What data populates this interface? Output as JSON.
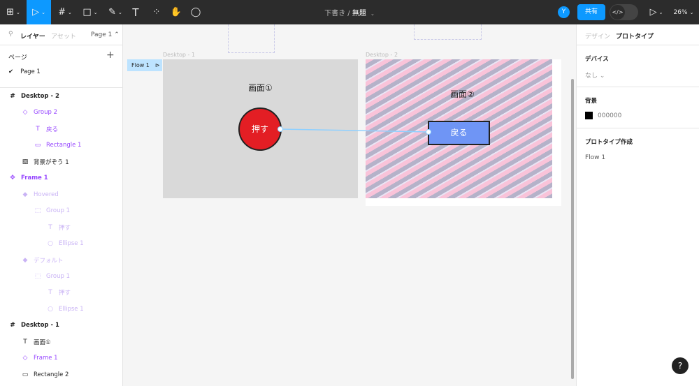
{
  "toolbar": {
    "tools": [
      "figma-menu-icon",
      "move-icon",
      "frame-icon",
      "rectangle-icon",
      "pen-icon",
      "text-icon",
      "components-icon",
      "hand-icon",
      "comment-icon"
    ],
    "breadcrumb": "下書き",
    "separator": "/",
    "file_name": "無題",
    "avatar": "Y",
    "share": "共有",
    "zoom": "26%"
  },
  "left": {
    "tab_layers": "レイヤー",
    "tab_assets": "アセット",
    "page_select": "Page 1",
    "pages_heading": "ページ",
    "pages": [
      "Page 1"
    ],
    "layers": [
      {
        "name": "Desktop - 2",
        "icon": "#",
        "indent": 0,
        "style": "bold"
      },
      {
        "name": "Group 2",
        "icon": "◇",
        "indent": 1,
        "style": "purple"
      },
      {
        "name": "戻る",
        "icon": "T",
        "indent": 2,
        "style": "purple"
      },
      {
        "name": "Rectangle 1",
        "icon": "▭",
        "indent": 2,
        "style": "purple"
      },
      {
        "name": "背景がぞう 1",
        "icon": "▨",
        "indent": 1,
        "style": ""
      },
      {
        "name": "Frame 1",
        "icon": "✥",
        "indent": 0,
        "style": "purple bold"
      },
      {
        "name": "Hovered",
        "icon": "◆",
        "indent": 1,
        "style": "faint"
      },
      {
        "name": "Group 1",
        "icon": "⬚",
        "indent": 2,
        "style": "faint"
      },
      {
        "name": "押す",
        "icon": "T",
        "indent": 3,
        "style": "faint"
      },
      {
        "name": "Ellipse 1",
        "icon": "○",
        "indent": 3,
        "style": "faint"
      },
      {
        "name": "デフォルト",
        "icon": "◆",
        "indent": 1,
        "style": "faint"
      },
      {
        "name": "Group 1",
        "icon": "⬚",
        "indent": 2,
        "style": "faint"
      },
      {
        "name": "押す",
        "icon": "T",
        "indent": 3,
        "style": "faint"
      },
      {
        "name": "Ellipse 1",
        "icon": "○",
        "indent": 3,
        "style": "faint"
      },
      {
        "name": "Desktop - 1",
        "icon": "#",
        "indent": 0,
        "style": "bold"
      },
      {
        "name": "画面①",
        "icon": "T",
        "indent": 1,
        "style": ""
      },
      {
        "name": "Frame 1",
        "icon": "◇",
        "indent": 1,
        "style": "purple"
      },
      {
        "name": "Rectangle 2",
        "icon": "▭",
        "indent": 1,
        "style": ""
      }
    ]
  },
  "canvas": {
    "flow_label": "Flow 1",
    "frame1_label": "Desktop - 1",
    "frame2_label": "Desktop - 2",
    "screen1_text": "画面①",
    "screen2_text": "画面②",
    "push_button": "押す",
    "back_button": "戻る"
  },
  "right": {
    "tab_design": "デザイン",
    "tab_prototype": "プロトタイプ",
    "device_heading": "デバイス",
    "device_value": "なし",
    "background_heading": "背景",
    "background_hex": "000000",
    "prototype_heading": "プロトタイプ作成",
    "flow": "Flow 1",
    "help": "?"
  },
  "colors": {
    "accent": "#0d99ff",
    "push": "#e31e24",
    "back": "#6f95f5",
    "background": "#000000"
  }
}
